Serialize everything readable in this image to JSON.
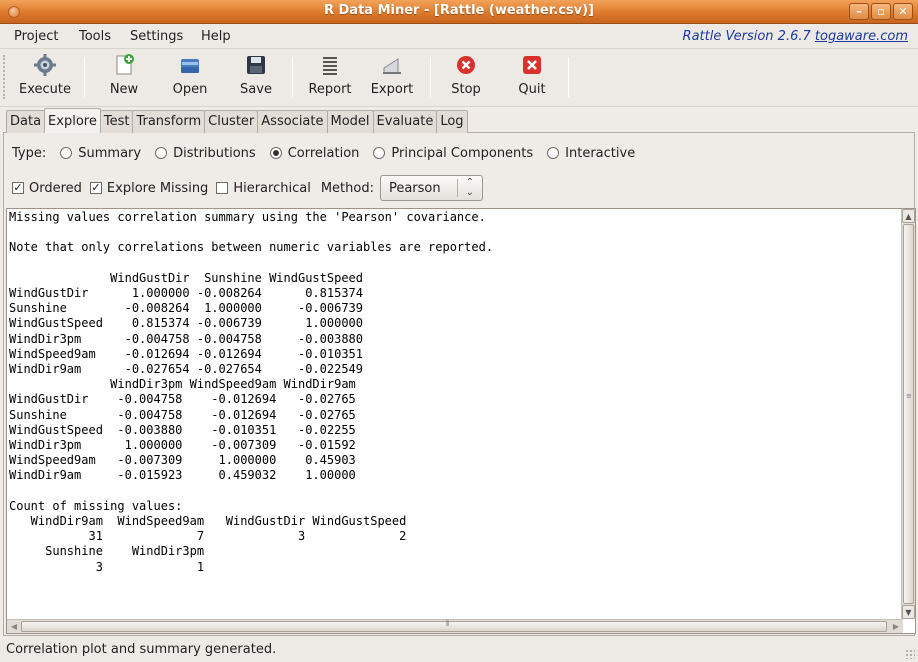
{
  "window": {
    "title": "R Data Miner - [Rattle (weather.csv)]",
    "controls": [
      "–",
      "▫",
      "✕"
    ]
  },
  "menu": {
    "items": [
      {
        "label": "Project",
        "mnemonic": "P"
      },
      {
        "label": "Tools",
        "mnemonic": "T"
      },
      {
        "label": "Settings",
        "mnemonic": "S"
      },
      {
        "label": "Help",
        "mnemonic": "H"
      }
    ],
    "version_text": "Rattle Version 2.6.7 ",
    "version_link": "togaware.com"
  },
  "toolbar": {
    "execute": "Execute",
    "new": "New",
    "open": "Open",
    "save": "Save",
    "report": "Report",
    "export": "Export",
    "stop": "Stop",
    "quit": "Quit"
  },
  "tabs": [
    "Data",
    "Explore",
    "Test",
    "Transform",
    "Cluster",
    "Associate",
    "Model",
    "Evaluate",
    "Log"
  ],
  "active_tab": "Explore",
  "type_row": {
    "label": "Type:",
    "options": [
      "Summary",
      "Distributions",
      "Correlation",
      "Principal Components",
      "Interactive"
    ],
    "selected": "Correlation"
  },
  "options_row": {
    "ordered": {
      "label": "Ordered",
      "checked": true
    },
    "explore_missing": {
      "label": "Explore Missing",
      "checked": true
    },
    "hierarchical": {
      "label": "Hierarchical",
      "checked": false
    },
    "method_label": "Method:",
    "method_value": "Pearson"
  },
  "output_lines": [
    "Missing values correlation summary using the 'Pearson' covariance.",
    "",
    "Note that only correlations between numeric variables are reported.",
    "",
    "              WindGustDir  Sunshine WindGustSpeed",
    "WindGustDir      1.000000 -0.008264      0.815374",
    "Sunshine        -0.008264  1.000000     -0.006739",
    "WindGustSpeed    0.815374 -0.006739      1.000000",
    "WindDir3pm      -0.004758 -0.004758     -0.003880",
    "WindSpeed9am    -0.012694 -0.012694     -0.010351",
    "WindDir9am      -0.027654 -0.027654     -0.022549",
    "              WindDir3pm WindSpeed9am WindDir9am",
    "WindGustDir    -0.004758    -0.012694   -0.02765",
    "Sunshine       -0.004758    -0.012694   -0.02765",
    "WindGustSpeed  -0.003880    -0.010351   -0.02255",
    "WindDir3pm      1.000000    -0.007309   -0.01592",
    "WindSpeed9am   -0.007309     1.000000    0.45903",
    "WindDir9am     -0.015923     0.459032    1.00000",
    "",
    "Count of missing values:",
    "   WindDir9am  WindSpeed9am   WindGustDir WindGustSpeed",
    "           31             7             3             2",
    "     Sunshine    WindDir3pm",
    "            3             1"
  ],
  "status": "Correlation plot and summary generated."
}
